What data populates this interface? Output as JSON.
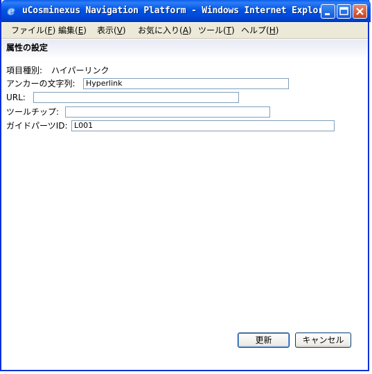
{
  "window": {
    "title": "uCosminexus Navigation Platform - Windows Internet Explorer",
    "icon": "ie-icon",
    "controls": {
      "minimize": "minimize-icon",
      "maximize": "maximize-icon",
      "close": "close-icon"
    }
  },
  "menu": [
    {
      "label": "ファイル(",
      "key": "F",
      "tail": ")"
    },
    {
      "label": "編集(",
      "key": "E",
      "tail": ")"
    },
    {
      "label": "表示(",
      "key": "V",
      "tail": ")"
    },
    {
      "label": "お気に入り(",
      "key": "A",
      "tail": ")"
    },
    {
      "label": "ツール(",
      "key": "T",
      "tail": ")"
    },
    {
      "label": "ヘルプ(",
      "key": "H",
      "tail": ")"
    }
  ],
  "section": {
    "title": "属性の設定"
  },
  "form": {
    "item_type": {
      "label": "項目種別:",
      "value": "ハイパーリンク"
    },
    "anchor_text": {
      "label": "アンカーの文字列:",
      "value": "Hyperlink"
    },
    "url": {
      "label": "URL:",
      "value": ""
    },
    "tooltip": {
      "label": "ツールチップ:",
      "value": ""
    },
    "guide_parts_id": {
      "label": "ガイドパーツID:",
      "value": "L001"
    }
  },
  "buttons": {
    "update": "更新",
    "cancel": "キャンセル"
  },
  "colors": {
    "titlebar": "#0054e3",
    "menubar": "#ece9d8",
    "field_border": "#7f9db9"
  }
}
